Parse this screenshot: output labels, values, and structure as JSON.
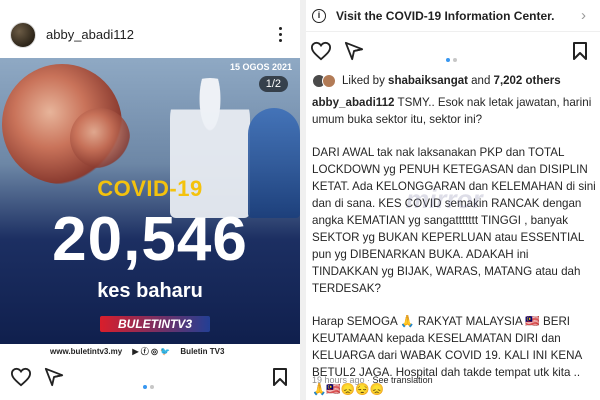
{
  "left_post": {
    "username": "abby_abadi112",
    "image": {
      "date": "15 OGOS 2021",
      "counter": "1/2",
      "title": "COVID-19",
      "number": "20,546",
      "subtitle": "kes baharu",
      "brand": "BULETINTV3",
      "footer": [
        "www.buletintv3.my",
        "Buletin TV3"
      ]
    },
    "icons": [
      "heart-icon",
      "share-icon",
      "bookmark-icon",
      "more-icon"
    ],
    "carousel": {
      "count": 2,
      "active": 1
    }
  },
  "right_post": {
    "banner": {
      "text": "Visit the COVID-19 Information Center.",
      "icon": "info-icon"
    },
    "likes": {
      "prefix": "Liked by",
      "user": "shabaiksangat",
      "middle": "and",
      "others": "7,202 others"
    },
    "caption": {
      "username": "abby_abadi112",
      "p1": "TSMY.. Esok nak letak jawatan, harini umum buka sektor itu, sektor ini?",
      "p2": "DARI AWAL tak nak laksanakan PKP dan TOTAL LOCKDOWN yg PENUH KETEGASAN dan DISIPLIN KETAT. Ada KELONGGARAN dan KELEMAHAN di sini dan di sana. KES COVID semakin RANCAK dengan angka KEMATIAN yg sangattttttt TINGGI , banyak SEKTOR yg BUKAN KEPERLUAN atau ESSENTIAL pun yg DIBENARKAN BUKA. ADAKAH ini TINDAKKAN yg BIJAK, WARAS, MATANG  atau dah TERDESAK?",
      "p3": "Harap SEMOGA 🙏 RAKYAT MALAYSIA 🇲🇾 BERI KEUTAMAAN kepada KESELAMATAN DIRI dan KELUARGA dari WABAK COVID 19. KALI INI KENA BETUL2 JAGA. Hospital dah takde tempat utk kita .. 🙏🇲🇾😞😔😞"
    },
    "timestamp": {
      "ago": "19 hours ago",
      "sep": " · ",
      "link": "See translation"
    },
    "watermark": "mirror"
  }
}
